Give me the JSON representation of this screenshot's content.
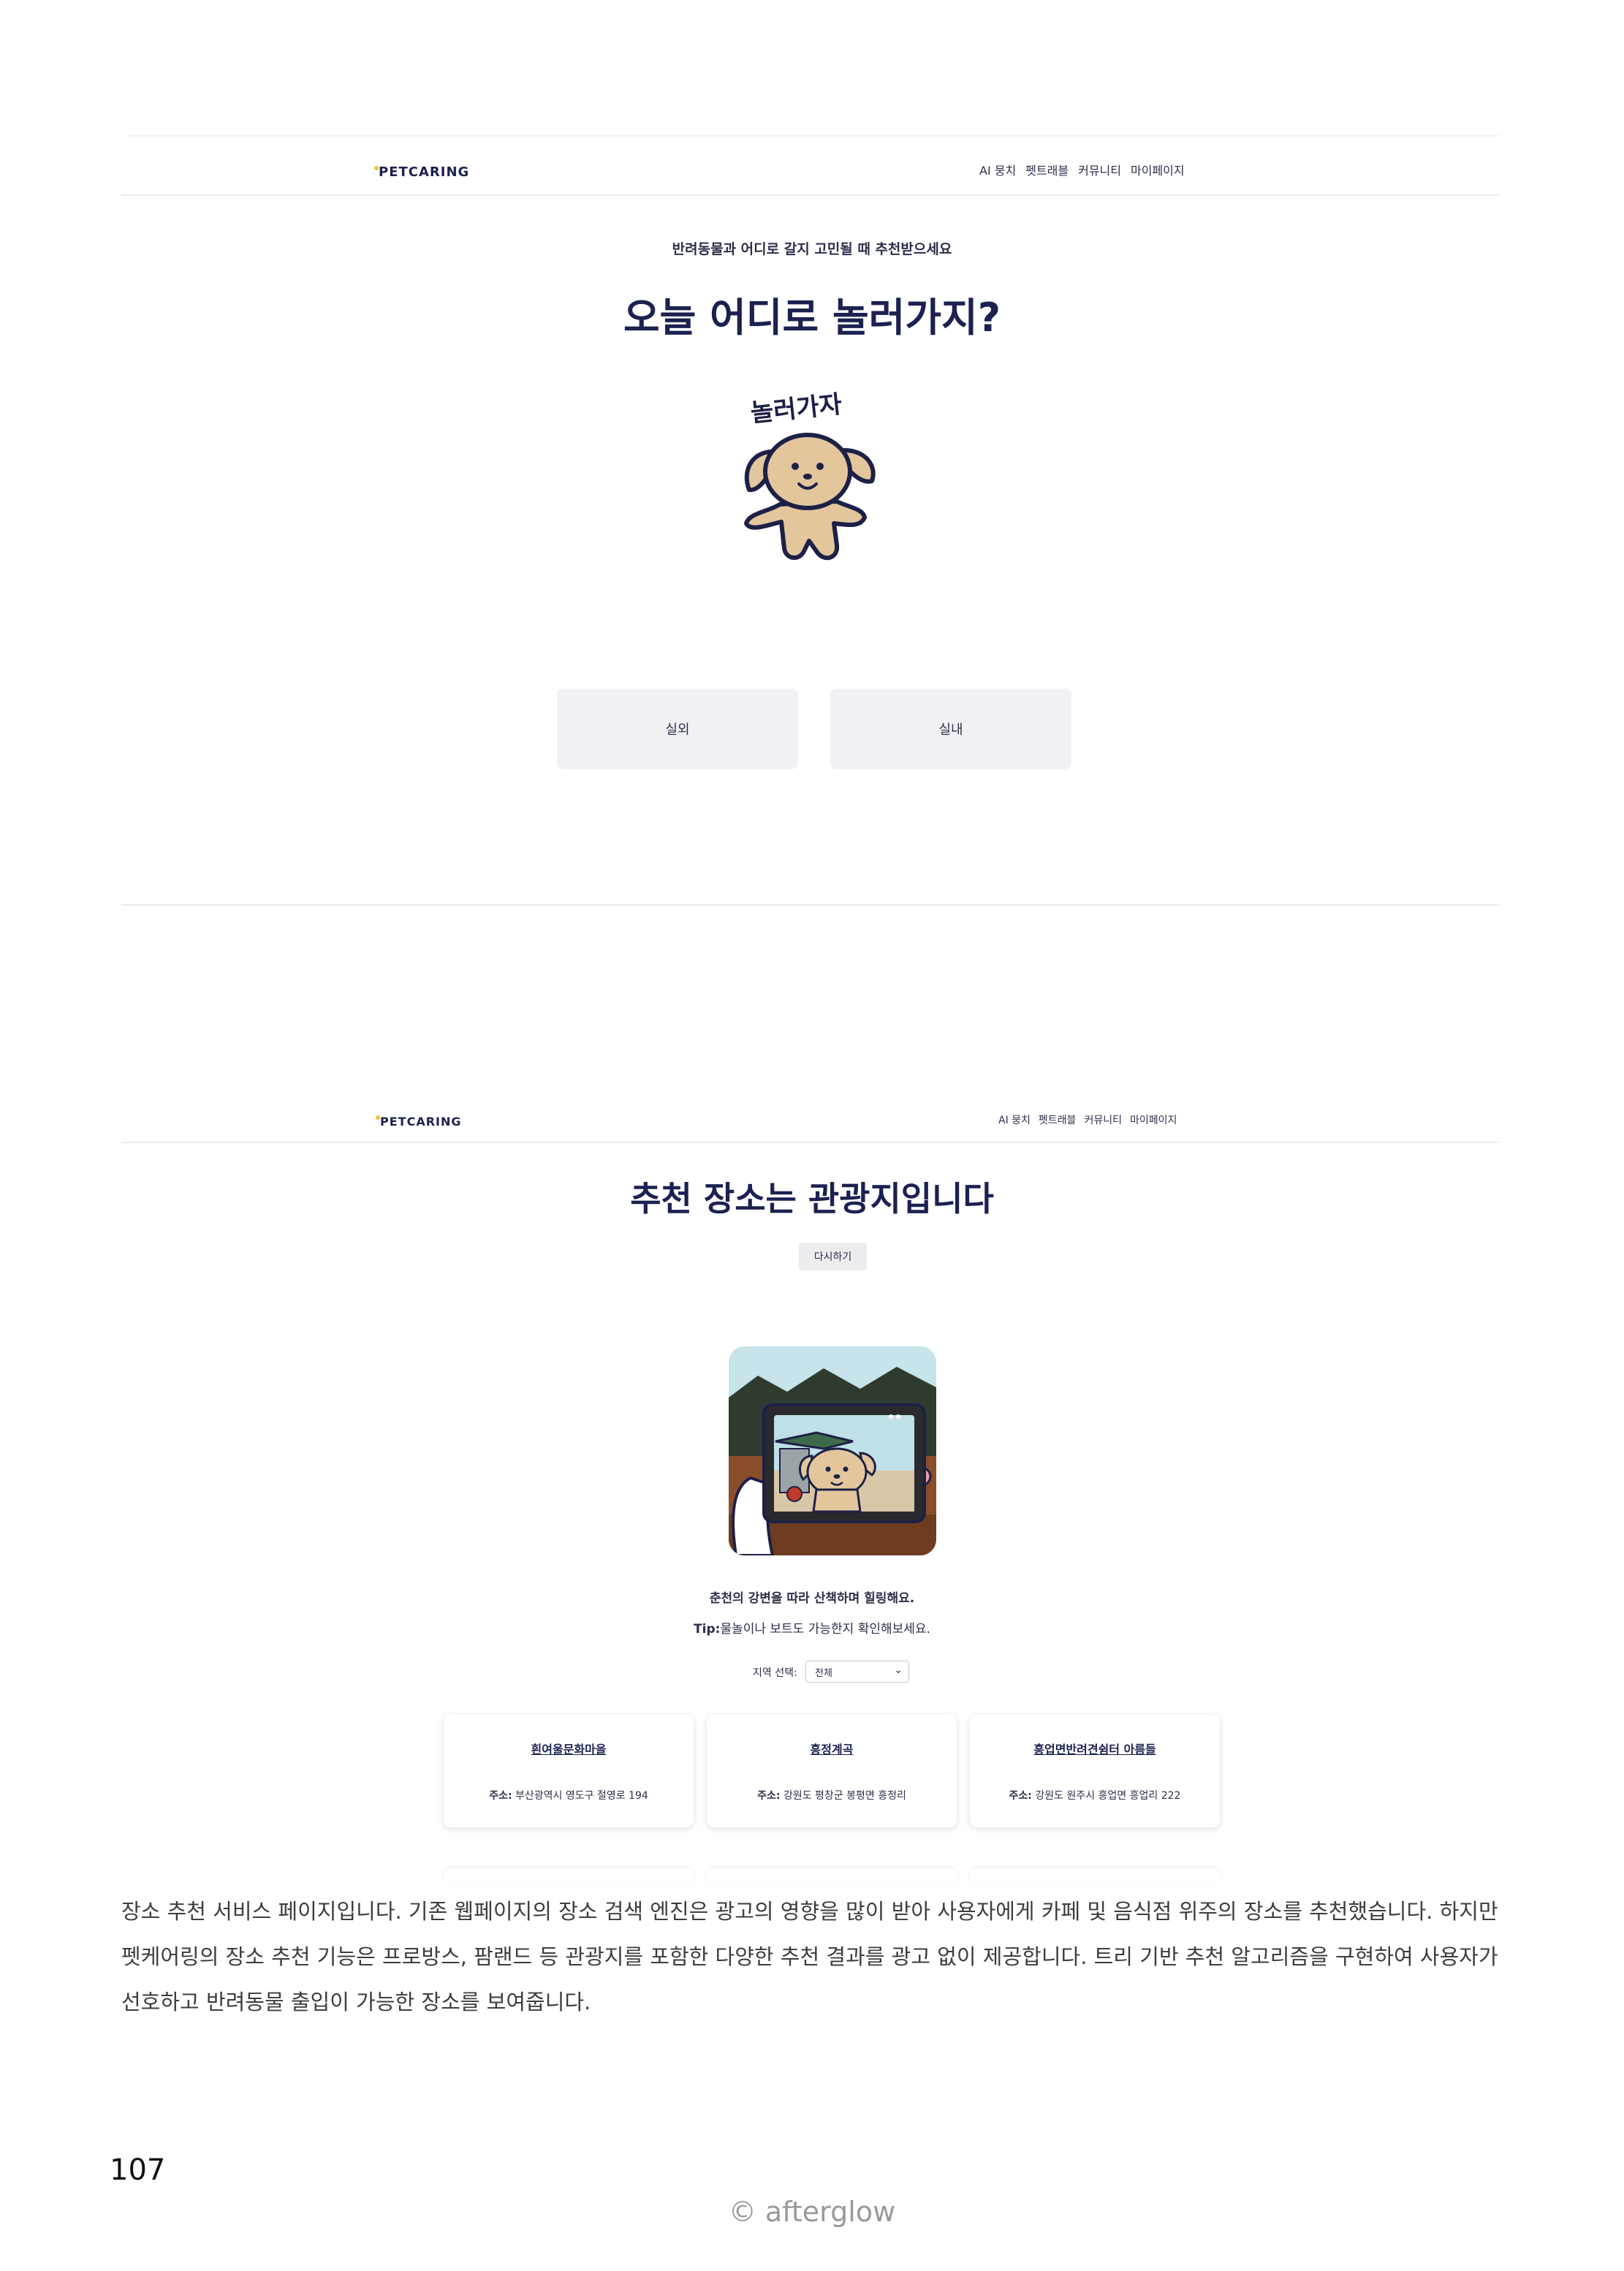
{
  "screen1": {
    "logo": "PETCARING",
    "nav": [
      "AI 뭉치",
      "펫트래블",
      "커뮤니티",
      "마이페이지"
    ],
    "subtitle": "반려동물과 어디로 갈지 고민될 때 추천받으세요",
    "title": "오늘 어디로 놀러가지?",
    "illustration_text": "놀러가자",
    "choices": [
      "실외",
      "실내"
    ]
  },
  "screen2": {
    "logo": "PETCARING",
    "nav": [
      "AI 뭉치",
      "펫트래블",
      "커뮤니티",
      "마이페이지"
    ],
    "title": "추천 장소는 관광지입니다",
    "retry_label": "다시하기",
    "description": "춘천의 강변을 따라 산책하며 힐링해요.",
    "tip_label": "Tip:",
    "tip_text": "물놀이나 보트도 가능한지 확인해보세요.",
    "region_label": "지역 선택:",
    "region_value": "전체",
    "address_label": "주소:",
    "places": [
      {
        "name": "흰여울문화마을",
        "address": "부산광역시 영도구 절영로 194"
      },
      {
        "name": "흥정계곡",
        "address": "강원도 평창군 봉평면 흥정리"
      },
      {
        "name": "흥업면반려견쉼터 아름들",
        "address": "강원도 원주시 흥업면 흥업리 222"
      }
    ]
  },
  "document": {
    "body": "장소 추천 서비스 페이지입니다. 기존 웹페이지의 장소 검색 엔진은 광고의 영향을 많이 받아 사용자에게 카페 및 음식점 위주의 장소를 추천했습니다. 하지만 펫케어링의 장소 추천 기능은 프로방스, 팜랜드 등 관광지를 포함한 다양한 추천 결과를 광고 없이 제공합니다. 트리 기반 추천 알고리즘을 구현하여 사용자가 선호하고 반려동물 출입이 가능한 장소를 보여줍니다.",
    "page_number": "107",
    "footer": "© afterglow"
  },
  "colors": {
    "navy": "#1b2150",
    "button_bg": "#f1f1f5",
    "dog_fur": "#e3c69c",
    "outline": "#1d2046"
  }
}
